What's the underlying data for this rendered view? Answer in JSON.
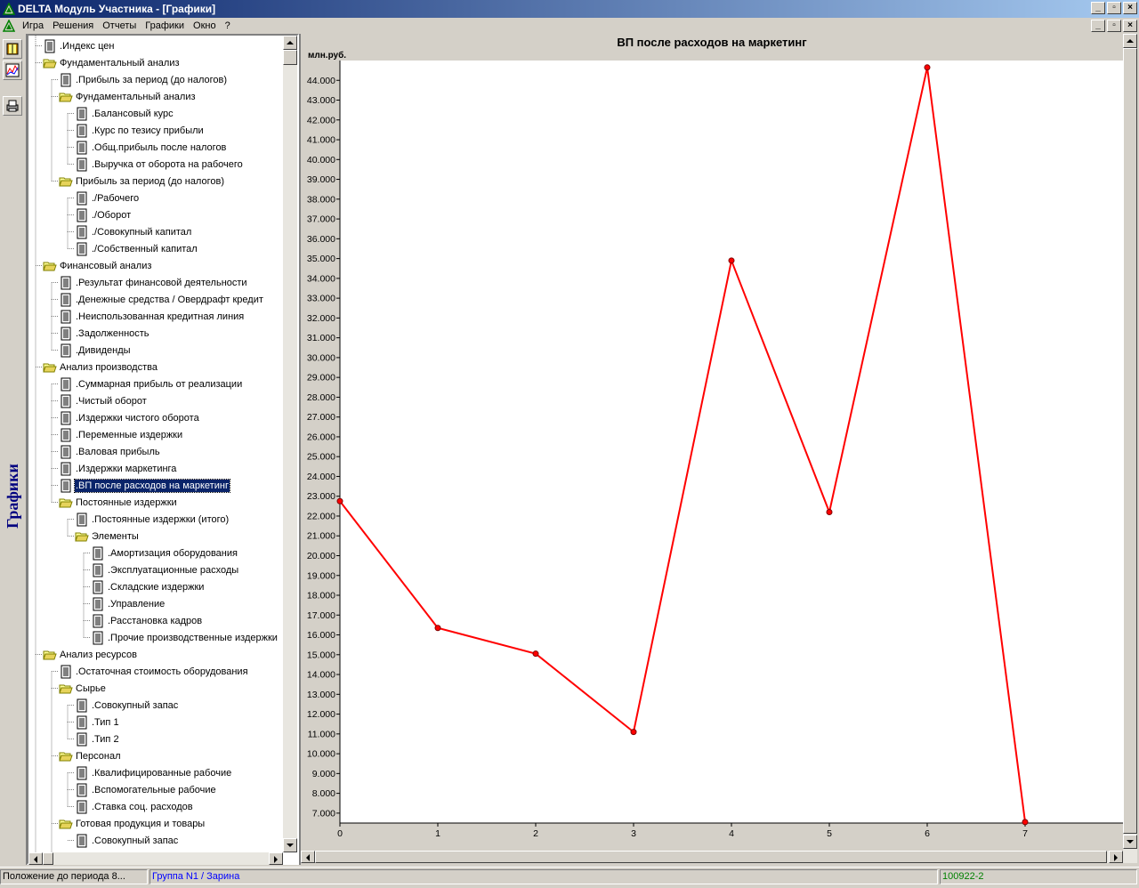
{
  "window": {
    "title": "DELTA Модуль Участника - [Графики]"
  },
  "menu": [
    "Игра",
    "Решения",
    "Отчеты",
    "Графики",
    "Окно",
    "?"
  ],
  "side_label": "Графики",
  "tree": [
    {
      "level": 1,
      "type": "doc",
      "label": ".Индекс цен"
    },
    {
      "level": 1,
      "type": "folder",
      "label": "Фундаментальный анализ"
    },
    {
      "level": 2,
      "type": "doc",
      "label": ".Прибыль за период (до налогов)"
    },
    {
      "level": 2,
      "type": "folder",
      "label": "Фундаментальный анализ"
    },
    {
      "level": 3,
      "type": "doc",
      "label": ".Балансовый курс"
    },
    {
      "level": 3,
      "type": "doc",
      "label": ".Курс по тезису прибыли"
    },
    {
      "level": 3,
      "type": "doc",
      "label": ".Общ.прибыль после налогов"
    },
    {
      "level": 3,
      "type": "doc",
      "label": ".Выручка от оборота на рабочего"
    },
    {
      "level": 2,
      "type": "folder",
      "label": "Прибыль за период (до налогов)"
    },
    {
      "level": 3,
      "type": "doc",
      "label": "./Рабочего"
    },
    {
      "level": 3,
      "type": "doc",
      "label": "./Оборот"
    },
    {
      "level": 3,
      "type": "doc",
      "label": "./Совокупный капитал"
    },
    {
      "level": 3,
      "type": "doc",
      "label": "./Собственный капитал"
    },
    {
      "level": 1,
      "type": "folder",
      "label": "Финансовый анализ"
    },
    {
      "level": 2,
      "type": "doc",
      "label": ".Результат финансовой деятельности"
    },
    {
      "level": 2,
      "type": "doc",
      "label": ".Денежные средства / Овердрафт кредит"
    },
    {
      "level": 2,
      "type": "doc",
      "label": ".Неиспользованная кредитная линия"
    },
    {
      "level": 2,
      "type": "doc",
      "label": ".Задолженность"
    },
    {
      "level": 2,
      "type": "doc",
      "label": ".Дивиденды"
    },
    {
      "level": 1,
      "type": "folder",
      "label": "Анализ производства"
    },
    {
      "level": 2,
      "type": "doc",
      "label": ".Суммарная прибыль от реализации"
    },
    {
      "level": 2,
      "type": "doc",
      "label": ".Чистый оборот"
    },
    {
      "level": 2,
      "type": "doc",
      "label": ".Издержки чистого оборота"
    },
    {
      "level": 2,
      "type": "doc",
      "label": ".Переменные издержки"
    },
    {
      "level": 2,
      "type": "doc",
      "label": ".Валовая прибыль"
    },
    {
      "level": 2,
      "type": "doc",
      "label": ".Издержки маркетинга"
    },
    {
      "level": 2,
      "type": "doc",
      "label": ".ВП после расходов на маркетинг",
      "selected": true
    },
    {
      "level": 2,
      "type": "folder",
      "label": "Постоянные издержки"
    },
    {
      "level": 3,
      "type": "doc",
      "label": ".Постоянные издержки (итого)"
    },
    {
      "level": 3,
      "type": "folder",
      "label": "Элементы"
    },
    {
      "level": 4,
      "type": "doc",
      "label": ".Амортизация оборудования"
    },
    {
      "level": 4,
      "type": "doc",
      "label": ".Эксплуатационные расходы"
    },
    {
      "level": 4,
      "type": "doc",
      "label": ".Складские издержки"
    },
    {
      "level": 4,
      "type": "doc",
      "label": ".Управление"
    },
    {
      "level": 4,
      "type": "doc",
      "label": ".Расстановка кадров"
    },
    {
      "level": 4,
      "type": "doc",
      "label": ".Прочие производственные издержки"
    },
    {
      "level": 1,
      "type": "folder",
      "label": "Анализ ресурсов"
    },
    {
      "level": 2,
      "type": "doc",
      "label": ".Остаточная стоимость оборудования"
    },
    {
      "level": 2,
      "type": "folder",
      "label": "Сырье"
    },
    {
      "level": 3,
      "type": "doc",
      "label": ".Совокупный запас"
    },
    {
      "level": 3,
      "type": "doc",
      "label": ".Тип 1"
    },
    {
      "level": 3,
      "type": "doc",
      "label": ".Тип 2"
    },
    {
      "level": 2,
      "type": "folder",
      "label": "Персонал"
    },
    {
      "level": 3,
      "type": "doc",
      "label": ".Квалифицированные рабочие"
    },
    {
      "level": 3,
      "type": "doc",
      "label": ".Вспомогательные рабочие"
    },
    {
      "level": 3,
      "type": "doc",
      "label": ".Ставка соц. расходов"
    },
    {
      "level": 2,
      "type": "folder",
      "label": "Готовая продукция и товары"
    },
    {
      "level": 3,
      "type": "doc",
      "label": ".Совокупный запас"
    }
  ],
  "chart_data": {
    "type": "line",
    "title": "ВП после расходов на маркетинг",
    "ylabel": "млн.руб.",
    "xlabel": "",
    "x": [
      0,
      1,
      2,
      3,
      4,
      5,
      6,
      7
    ],
    "values": [
      22.75,
      16.35,
      15.05,
      11.1,
      34.9,
      22.2,
      44.65,
      6.55
    ],
    "ylim": [
      6.5,
      45.0
    ],
    "yticks": [
      "7.000",
      "8.000",
      "9.000",
      "10.000",
      "11.000",
      "12.000",
      "13.000",
      "14.000",
      "15.000",
      "16.000",
      "17.000",
      "18.000",
      "19.000",
      "20.000",
      "21.000",
      "22.000",
      "23.000",
      "24.000",
      "25.000",
      "26.000",
      "27.000",
      "28.000",
      "29.000",
      "30.000",
      "31.000",
      "32.000",
      "33.000",
      "34.000",
      "35.000",
      "36.000",
      "37.000",
      "38.000",
      "39.000",
      "40.000",
      "41.000",
      "42.000",
      "43.000",
      "44.000"
    ],
    "xticks": [
      "0",
      "1",
      "2",
      "3",
      "4",
      "5",
      "6",
      "7"
    ],
    "line_color": "#ff0000",
    "grid": false
  },
  "status": {
    "left": "Положение до периода 8...",
    "group": "Группа N1 / Зарина",
    "code": "100922-2",
    "group_color": "#0000ff",
    "code_color": "#008000"
  }
}
